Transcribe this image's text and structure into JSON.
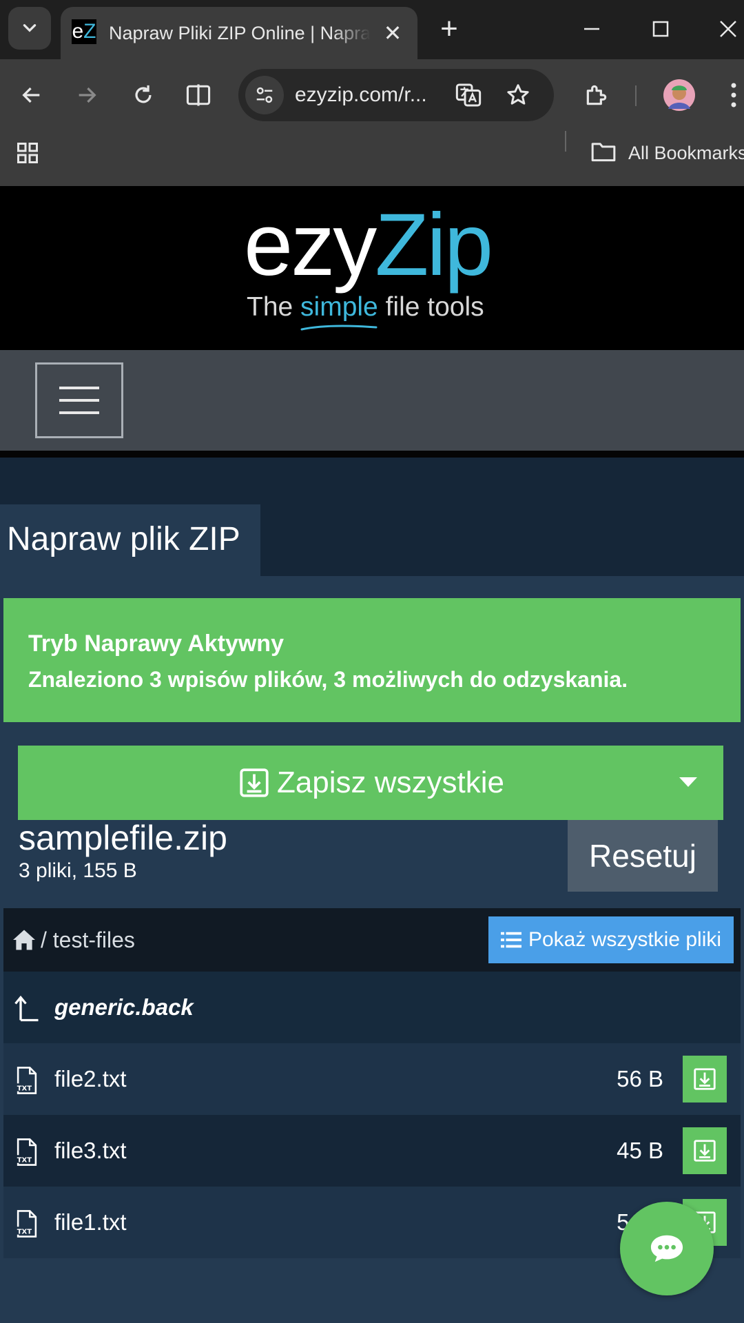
{
  "browser": {
    "tab": {
      "favicon_text_e": "e",
      "favicon_text_z": "Z",
      "title": "Napraw Pliki ZIP Online | Napraw Pliki ZIP",
      "close_glyph": "✕"
    },
    "new_tab_glyph": "+",
    "address_bar": {
      "url": "ezyzip.com/r..."
    },
    "bookmarks": {
      "all_label": "All Bookmarks"
    }
  },
  "site": {
    "logo": {
      "part1": "ezy",
      "part2": "Zip"
    },
    "tagline": {
      "before": "The ",
      "highlight": "simple",
      "after": " file tools"
    }
  },
  "page": {
    "title": "Napraw plik ZIP",
    "alert": {
      "title": "Tryb Naprawy Aktywny",
      "message": "Znaleziono 3 wpisów plików, 3 możliwych do odzyskania."
    },
    "save_all_label": "Zapisz wszystkie",
    "archive": {
      "name": "samplefile.zip",
      "info": "3 pliki, 155 B"
    },
    "reset_label": "Resetuj",
    "browser_panel": {
      "path": "/ test-files",
      "show_all_label": "Pokaż wszystkie pliki",
      "back_entry": "generic.back",
      "files": [
        {
          "name": "file2.txt",
          "size": "56 B"
        },
        {
          "name": "file3.txt",
          "size": "45 B"
        },
        {
          "name": "file1.txt",
          "size": "54 B"
        }
      ]
    }
  },
  "colors": {
    "accent_green": "#62c462",
    "accent_blue": "#4a9fe8",
    "logo_cyan": "#3fb8dc",
    "page_bg": "#243a51"
  }
}
